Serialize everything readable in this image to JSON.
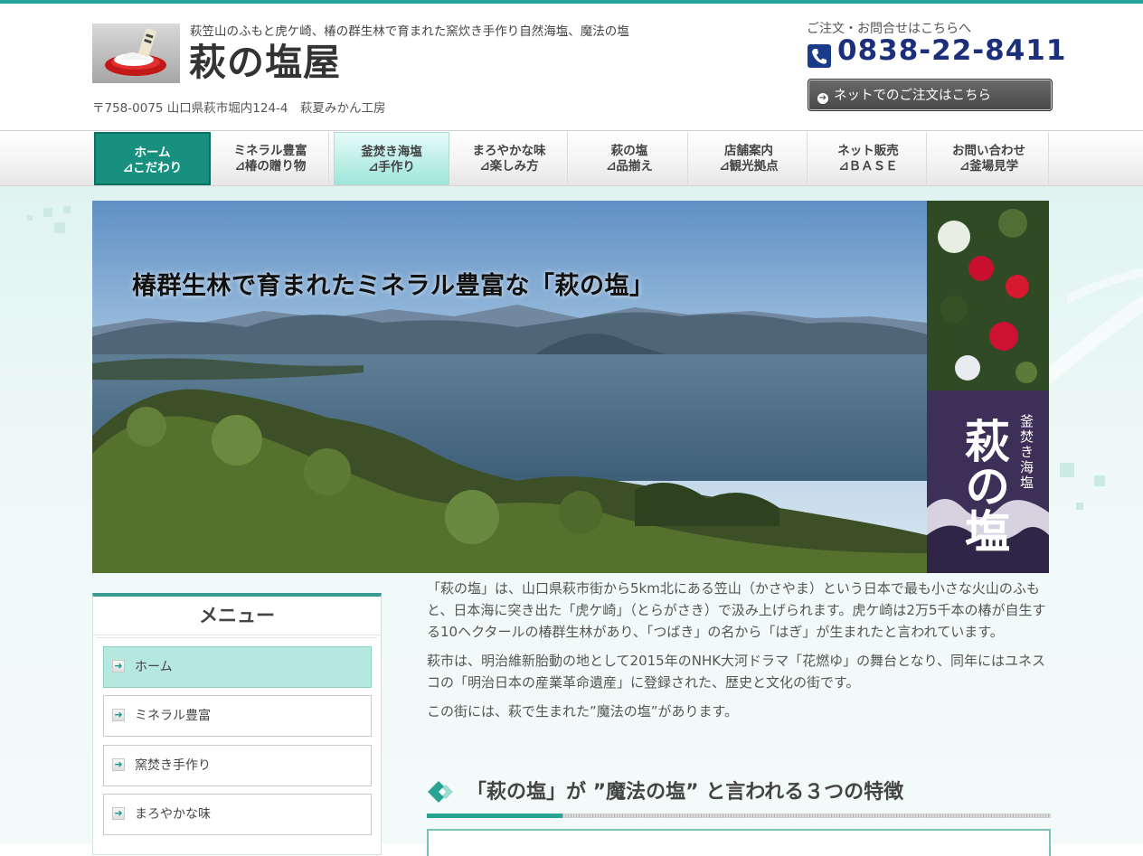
{
  "header": {
    "tagline": "萩笠山のふもと虎ケ崎、椿の群生林で育まれた窯炊き手作り自然海塩、魔法の塩",
    "site_title": "萩の塩屋",
    "address": "〒758-0075 山口県萩市堀内124-4　萩夏みかん工房",
    "contact_label": "ご注文・お問合せはこちらへ",
    "phone": "0838-22-8411",
    "order_button": "ネットでのご注文はこちら",
    "logo_icon": "salt-dish-logo",
    "phone_icon": "phone-icon"
  },
  "nav": {
    "items": [
      {
        "line1": "ホーム",
        "line2": "⊿こだわり"
      },
      {
        "line1": "ミネラル豊富",
        "line2": "⊿椿の贈り物"
      },
      {
        "line1": "釜焚き海塩",
        "line2": "⊿手作り"
      },
      {
        "line1": "まろやかな味",
        "line2": "⊿楽しみ方"
      },
      {
        "line1": "萩の塩",
        "line2": "⊿品揃え"
      },
      {
        "line1": "店舗案内",
        "line2": "⊿観光拠点"
      },
      {
        "line1": "ネット販売",
        "line2": "⊿ＢＡＳＥ"
      },
      {
        "line1": "お問い合わせ",
        "line2": "⊿釜場見学"
      }
    ]
  },
  "hero": {
    "caption": "椿群生林で育まれたミネラル豊富な「萩の塩」",
    "side_label_big": "萩の塩",
    "side_label_small": "釜焚き海塩"
  },
  "sidebar": {
    "title": "メニュー",
    "items": [
      {
        "label": "ホーム"
      },
      {
        "label": "ミネラル豊富"
      },
      {
        "label": "窯焚き手作り"
      },
      {
        "label": "まろやかな味"
      }
    ]
  },
  "main": {
    "paragraphs": [
      "「萩の塩」は、山口県萩市街から5km北にある笠山（かさやま）という日本で最も小さな火山のふもと、日本海に突き出た「虎ケ崎」（とらがさき）で汲み上げられます。虎ケ崎は2万5千本の椿が自生する10ヘクタールの椿群生林があり、「つばき」の名から「はぎ」が生まれたと言われています。",
      "萩市は、明治維新胎動の地として2015年のNHK大河ドラマ「花燃ゆ」の舞台となり、同年にはユネスコの「明治日本の産業革命遺産」に登録された、歴史と文化の街です。",
      "この街には、萩で生まれた”魔法の塩”があります。"
    ],
    "section_heading": "「萩の塩」が ”魔法の塩” と言われる３つの特徴"
  },
  "colors": {
    "accent": "#17907f",
    "phone": "#1c2f7a",
    "menu_active": "#b5e8df"
  }
}
